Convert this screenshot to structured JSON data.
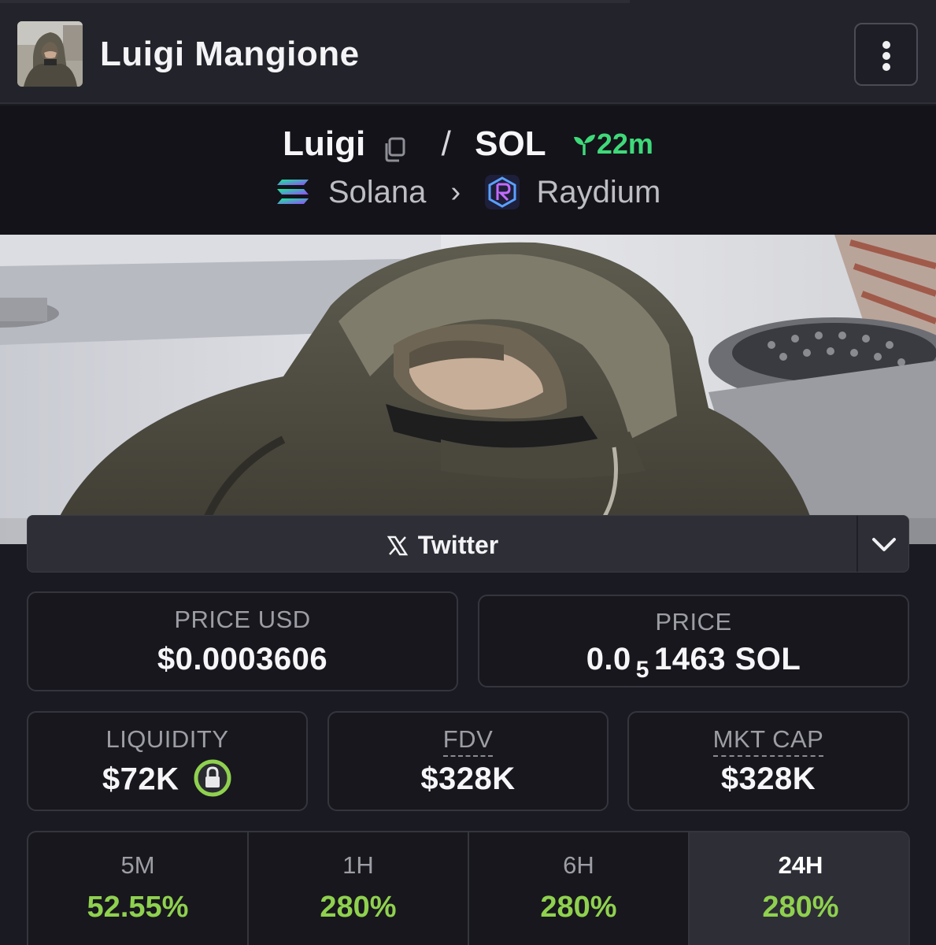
{
  "header": {
    "title": "Luigi Mangione",
    "menu_icon": "kebab-menu-icon"
  },
  "pair": {
    "base": "Luigi",
    "separator": "/",
    "quote": "SOL",
    "age": "22m",
    "chain": "Solana",
    "dex": "Raydium",
    "age_color": "#3fd97a"
  },
  "social": {
    "twitter_label": "Twitter"
  },
  "price": {
    "usd_label": "PRICE USD",
    "usd_value": "$0.0003606",
    "native_label": "PRICE",
    "native_prefix": "0.0",
    "native_subscript": "5",
    "native_suffix": "1463 SOL"
  },
  "stats": {
    "liquidity_label": "LIQUIDITY",
    "liquidity_value": "$72K",
    "fdv_label": "FDV",
    "fdv_value": "$328K",
    "mktcap_label": "MKT CAP",
    "mktcap_value": "$328K"
  },
  "timeframes": [
    {
      "label": "5M",
      "value": "52.55%"
    },
    {
      "label": "1H",
      "value": "280%"
    },
    {
      "label": "6H",
      "value": "280%"
    },
    {
      "label": "24H",
      "value": "280%",
      "active": true
    }
  ],
  "colors": {
    "positive": "#8fd14f",
    "lock_ring": "#8fd14f"
  }
}
